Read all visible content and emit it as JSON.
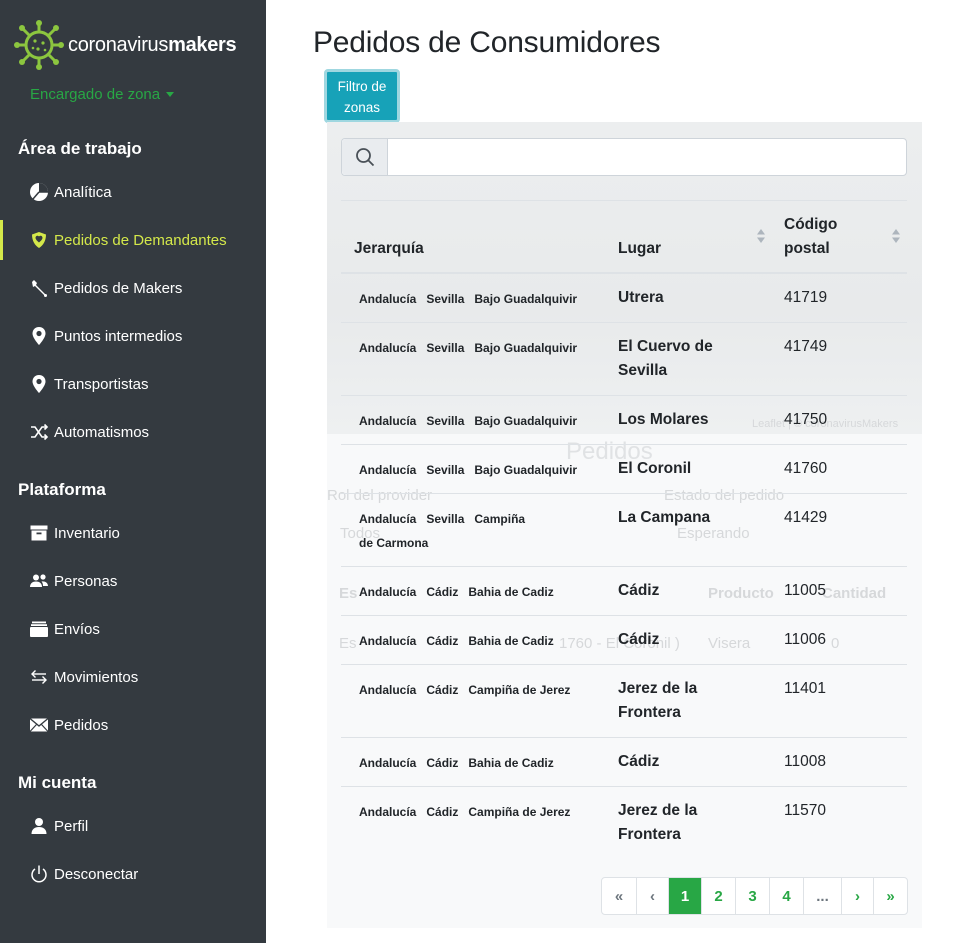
{
  "brand": {
    "name_prefix": "coronavirus",
    "name_suffix": "makers"
  },
  "role": {
    "label": "Encargado de zona"
  },
  "sidebar": {
    "sections": [
      {
        "title": "Área de trabajo"
      },
      {
        "title": "Plataforma"
      },
      {
        "title": "Mi cuenta"
      }
    ],
    "items": [
      {
        "label": "Analítica",
        "icon": "pie-chart-icon"
      },
      {
        "label": "Pedidos de Demandantes",
        "icon": "heart-shield-icon",
        "active": true
      },
      {
        "label": "Pedidos de Makers",
        "icon": "wrench-icon"
      },
      {
        "label": "Puntos intermedios",
        "icon": "map-marker-icon"
      },
      {
        "label": "Transportistas",
        "icon": "map-marker-icon"
      },
      {
        "label": "Automatismos",
        "icon": "shuffle-icon"
      },
      {
        "label": "Inventario",
        "icon": "archive-icon"
      },
      {
        "label": "Personas",
        "icon": "users-icon"
      },
      {
        "label": "Envíos",
        "icon": "box-icon"
      },
      {
        "label": "Movimientos",
        "icon": "exchange-icon"
      },
      {
        "label": "Pedidos",
        "icon": "envelope-icon"
      },
      {
        "label": "Perfil",
        "icon": "user-icon"
      },
      {
        "label": "Desconectar",
        "icon": "power-icon"
      }
    ]
  },
  "page": {
    "title": "Pedidos de Consumidores",
    "filter_button": "Filtro de zonas"
  },
  "search": {
    "value": "",
    "placeholder": ""
  },
  "background_ghost": {
    "heading": "Pedidos",
    "rol_label": "Rol del provider",
    "estado_label": "Estado del pedido",
    "rol_value": "Todos",
    "estado_value": "Esperando",
    "col_es": "Es",
    "col_producto": "Producto",
    "col_cantidad": "Cantidad",
    "row_es": "Es",
    "row_id": "1760 - El Coronil )",
    "row_producto": "Visera",
    "row_cantidad": "0",
    "map_credit": "Leaflet | © coronavirusMakers"
  },
  "table": {
    "headers": {
      "hierarchy": "Jerarquía",
      "place": "Lugar",
      "postal": "Código postal"
    },
    "rows": [
      {
        "h": [
          "Andalucía",
          "Sevilla",
          "Bajo Guadalquivir"
        ],
        "place": "Utrera",
        "cp": "41719"
      },
      {
        "h": [
          "Andalucía",
          "Sevilla",
          "Bajo Guadalquivir"
        ],
        "place": "El Cuervo de Sevilla",
        "cp": "41749"
      },
      {
        "h": [
          "Andalucía",
          "Sevilla",
          "Bajo Guadalquivir"
        ],
        "place": "Los Molares",
        "cp": "41750"
      },
      {
        "h": [
          "Andalucía",
          "Sevilla",
          "Bajo Guadalquivir"
        ],
        "place": "El Coronil",
        "cp": "41760"
      },
      {
        "h": [
          "Andalucía",
          "Sevilla",
          "Campiña de Carmona"
        ],
        "place": "La Campana",
        "cp": "41429"
      },
      {
        "h": [
          "Andalucía",
          "Cádiz",
          "Bahia de Cadiz"
        ],
        "place": "Cádiz",
        "cp": "11005"
      },
      {
        "h": [
          "Andalucía",
          "Cádiz",
          "Bahia de Cadiz"
        ],
        "place": "Cádiz",
        "cp": "11006"
      },
      {
        "h": [
          "Andalucía",
          "Cádiz",
          "Campiña de Jerez"
        ],
        "place": "Jerez de la Frontera",
        "cp": "11401"
      },
      {
        "h": [
          "Andalucía",
          "Cádiz",
          "Bahia de Cadiz"
        ],
        "place": "Cádiz",
        "cp": "11008"
      },
      {
        "h": [
          "Andalucía",
          "Cádiz",
          "Campiña de Jerez"
        ],
        "place": "Jerez de la Frontera",
        "cp": "11570"
      }
    ]
  },
  "pagination": {
    "first": "«",
    "prev": "‹",
    "pages": [
      "1",
      "2",
      "3",
      "4"
    ],
    "ellipsis": "...",
    "next": "›",
    "last": "»",
    "current": "1"
  },
  "colors": {
    "sidebar_bg": "#343a40",
    "accent_green": "#28a745",
    "active_item": "#d4e84a",
    "filter_button": "#17a2b8"
  }
}
